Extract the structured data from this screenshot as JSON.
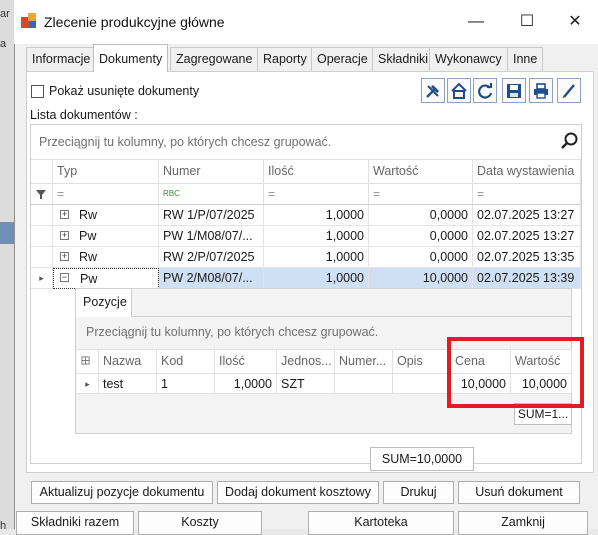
{
  "background_window": {
    "cells": [
      "ar",
      "a",
      "",
      "h"
    ]
  },
  "window": {
    "title": "Zlecenie produkcyjne główne",
    "controls": {
      "minimize": "—",
      "maximize": "☐",
      "close": "✕"
    }
  },
  "tabs": [
    {
      "label": "Informacje",
      "active": false
    },
    {
      "label": "Dokumenty",
      "active": true
    },
    {
      "label": "Zagregowane",
      "active": false
    },
    {
      "label": "Raporty",
      "active": false
    },
    {
      "label": "Operacje",
      "active": false
    },
    {
      "label": "Składniki",
      "active": false
    },
    {
      "label": "Wykonawcy",
      "active": false
    },
    {
      "label": "Inne",
      "active": false
    }
  ],
  "show_deleted": {
    "label": "Pokaż usunięte dokumenty",
    "checked": false
  },
  "toolbar_icons": [
    "tools-icon",
    "home-icon",
    "refresh-icon",
    "save-icon",
    "print-icon",
    "edit-icon"
  ],
  "list_label": "Lista dokumentów  :",
  "grid": {
    "group_hint": "Przeciągnij tu kolumny, po których chcesz grupować.",
    "columns": [
      "Typ",
      "Numer",
      "Ilość",
      "Wartość",
      "Data wystawienia"
    ],
    "filter_symbols": [
      "=",
      "RBC",
      "=",
      "=",
      "="
    ],
    "rows": [
      {
        "expander": "+",
        "typ": "Rw",
        "numer": "RW 1/P/07/2025",
        "ilosc": "1,0000",
        "wartosc": "0,0000",
        "data": "02.07.2025 13:27"
      },
      {
        "expander": "+",
        "typ": "Pw",
        "numer": "PW 1/M08/07/...",
        "ilosc": "1,0000",
        "wartosc": "0,0000",
        "data": "02.07.2025 13:27"
      },
      {
        "expander": "+",
        "typ": "Rw",
        "numer": "RW 2/P/07/2025",
        "ilosc": "1,0000",
        "wartosc": "0,0000",
        "data": "02.07.2025 13:35"
      },
      {
        "expander": "−",
        "typ": "Pw",
        "numer": "PW 2/M08/07/...",
        "ilosc": "1,0000",
        "wartosc": "10,0000",
        "data": "02.07.2025 13:39"
      }
    ],
    "sum": "SUM=10,0000"
  },
  "detail": {
    "tab": "Pozycje",
    "group_hint": "Przeciągnij tu kolumny, po których chcesz grupować.",
    "columns": [
      "Nazwa",
      "Kod",
      "Ilość",
      "Jednos...",
      "Numer...",
      "Opis",
      "Cena",
      "Wartość"
    ],
    "rows": [
      {
        "nazwa": "test",
        "kod": "1",
        "ilosc": "1,0000",
        "jednostka": "SZT",
        "numer": "",
        "opis": "",
        "cena": "10,0000",
        "wartosc": "10,0000"
      }
    ],
    "sum": "SUM=1..."
  },
  "buttons": {
    "update": "Aktualizuj pozycje dokumentu",
    "add_cost": "Dodaj dokument kosztowy",
    "print": "Drukuj",
    "delete": "Usuń dokument"
  },
  "bottom_buttons": [
    "Składniki razem",
    "Koszty",
    "Kartoteka",
    "Zamknij"
  ],
  "colors": {
    "highlight": "#e31b23",
    "selected_row": "#cfe0f5",
    "toolbar_icon": "#1f4e8c"
  }
}
